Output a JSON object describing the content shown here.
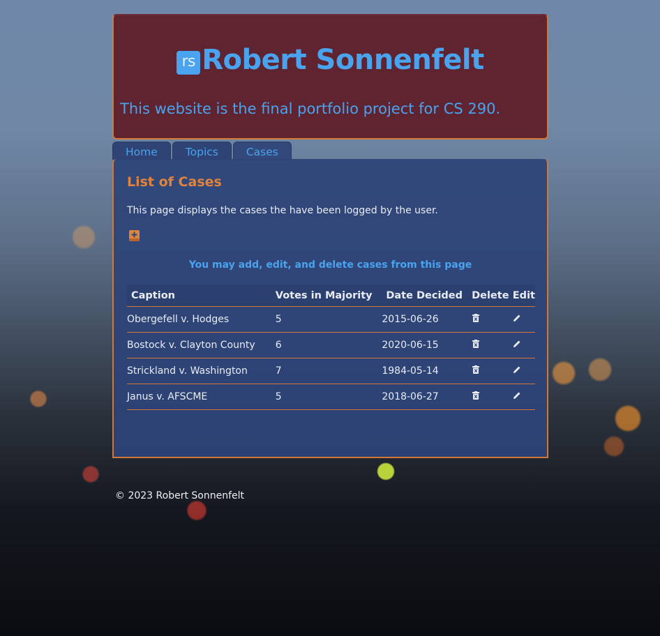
{
  "header": {
    "logo_text": "rs",
    "site_title": "Robert Sonnenfelt",
    "tagline": "This website is the final portfolio project for CS 290."
  },
  "nav": {
    "tabs": [
      {
        "label": "Home"
      },
      {
        "label": "Topics"
      },
      {
        "label": "Cases"
      }
    ],
    "active": "Cases"
  },
  "main": {
    "heading": "List of Cases",
    "intro": "This page displays the cases the have been logged by the user.",
    "add_icon": "add-case-icon",
    "notice": "You may add, edit, and delete cases from this page"
  },
  "table": {
    "columns": [
      "Caption",
      "Votes in Majority",
      "Date Decided",
      "Delete",
      "Edit"
    ],
    "rows": [
      {
        "caption": "Obergefell v. Hodges",
        "votes": "5",
        "date": "2015-06-26"
      },
      {
        "caption": "Bostock v. Clayton County",
        "votes": "6",
        "date": "2020-06-15"
      },
      {
        "caption": "Strickland v. Washington",
        "votes": "7",
        "date": "1984-05-14"
      },
      {
        "caption": "Janus v. AFSCME",
        "votes": "5",
        "date": "2018-06-27"
      }
    ],
    "delete_icon": "trash-icon",
    "edit_icon": "pencil-icon"
  },
  "footer": {
    "text": "© 2023 Robert Sonnenfelt"
  },
  "colors": {
    "accent_blue": "#4aa3ee",
    "accent_orange": "#e0833c",
    "header_bg": "#5f2430",
    "panel_bg": "#2d4478"
  }
}
